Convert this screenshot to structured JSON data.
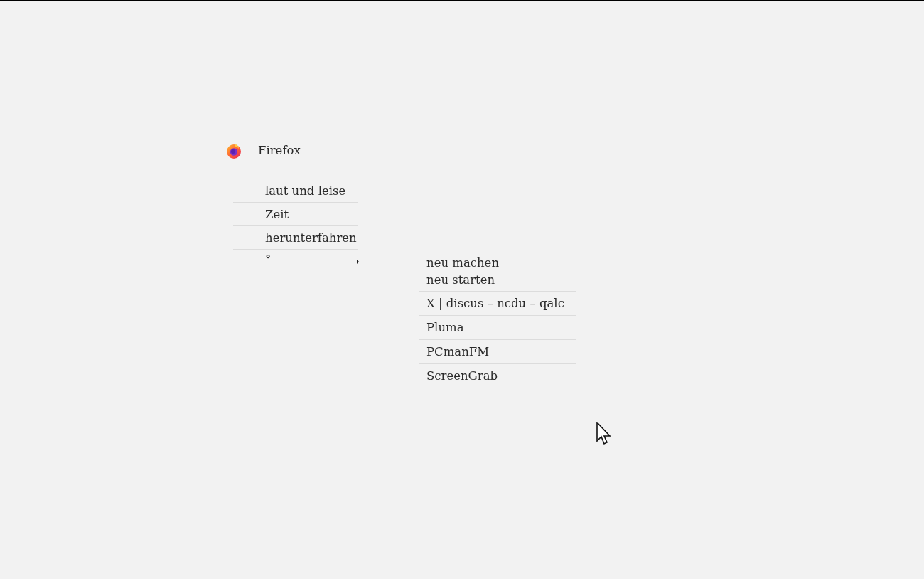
{
  "menu": {
    "items": [
      {
        "kind": "app",
        "label": "Firefox"
      },
      {
        "kind": "plain",
        "label": "laut und leise"
      },
      {
        "kind": "plain",
        "label": "Zeit"
      },
      {
        "kind": "plain",
        "label": "herunterfahren"
      },
      {
        "kind": "submenu",
        "label": "°"
      }
    ]
  },
  "submenu": {
    "items": [
      {
        "label": "neu machen",
        "separator_before": false
      },
      {
        "label": "neu starten",
        "separator_before": false
      },
      {
        "label": "X | discus – ncdu – qalc",
        "separator_before": true
      },
      {
        "label": "Pluma",
        "separator_before": true
      },
      {
        "label": "PCmanFM",
        "separator_before": true
      },
      {
        "label": "ScreenGrab",
        "separator_before": true
      }
    ]
  }
}
